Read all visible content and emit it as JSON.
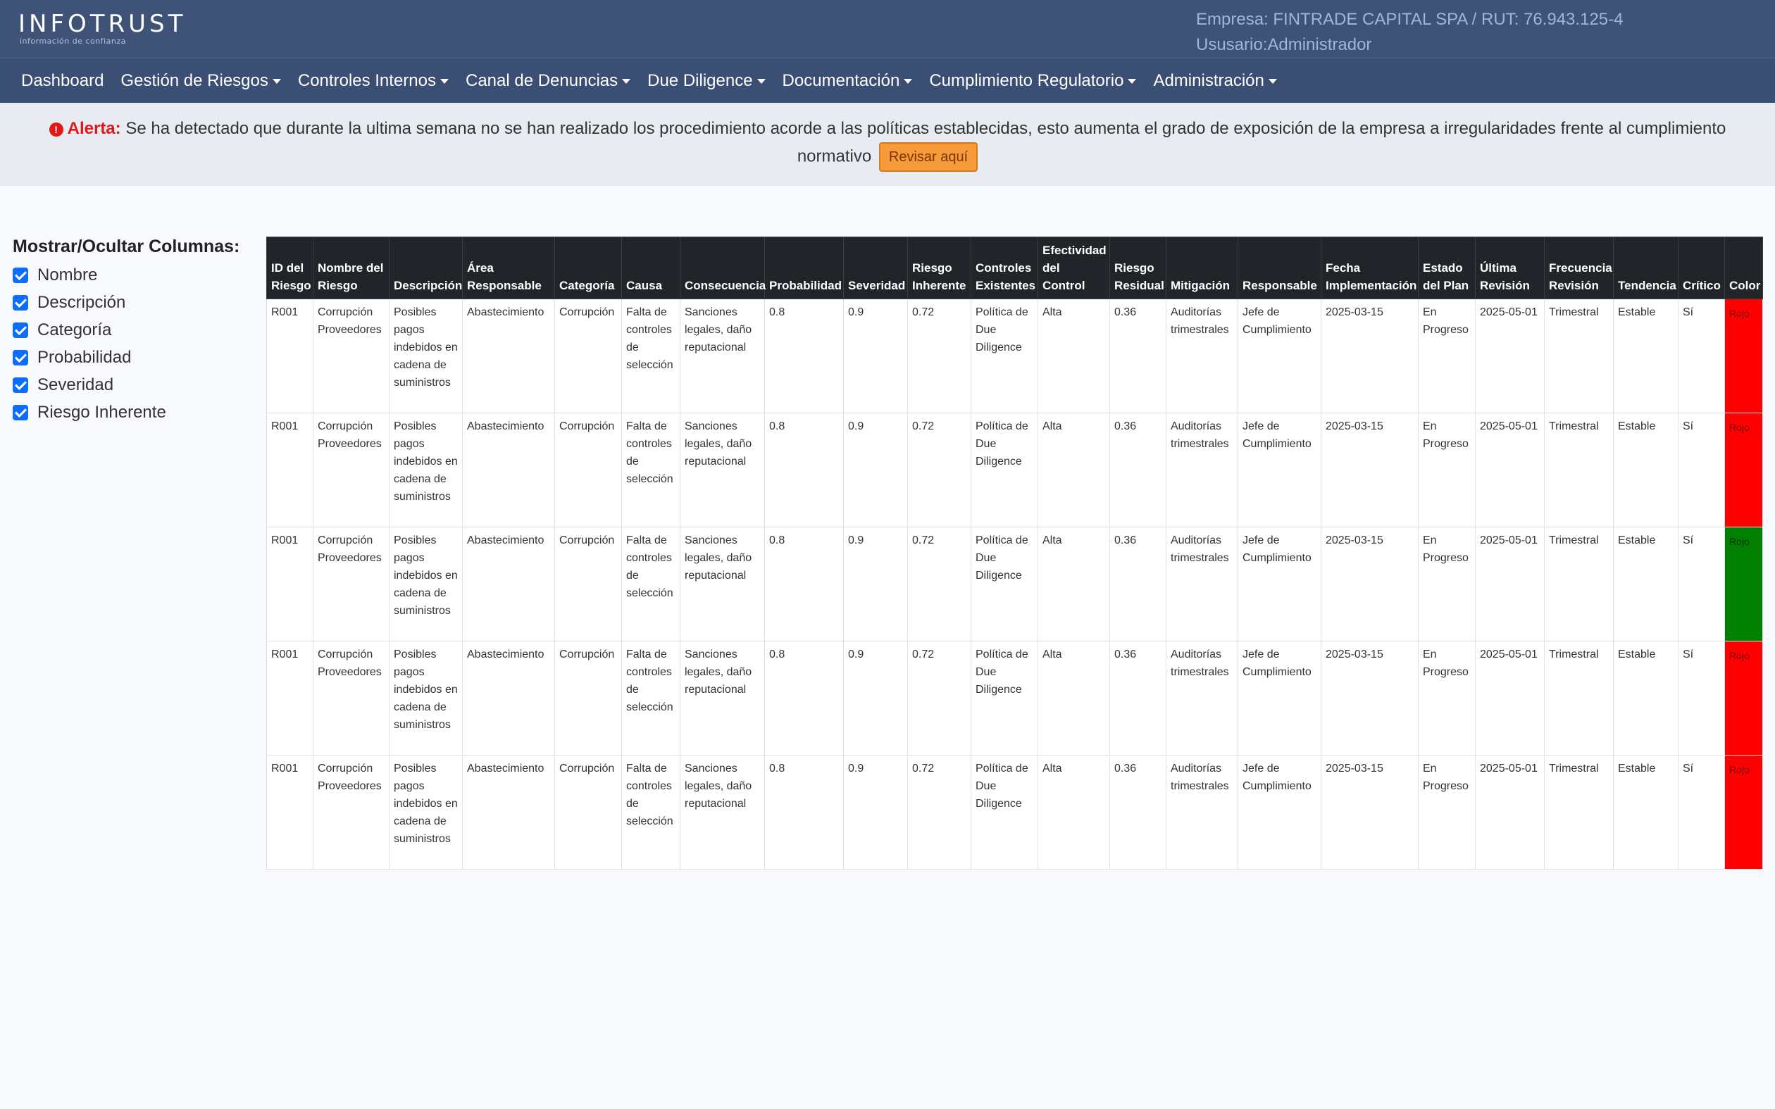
{
  "header": {
    "logo_text": "INFOTRUST",
    "logo_tagline": "información de confianza",
    "company": "Empresa: FINTRADE CAPITAL SPA / RUT: 76.943.125-4",
    "user": "Ususario:Administrador"
  },
  "nav": {
    "items": [
      {
        "label": "Dashboard",
        "dropdown": false
      },
      {
        "label": "Gestión de Riesgos",
        "dropdown": true
      },
      {
        "label": "Controles Internos",
        "dropdown": true
      },
      {
        "label": "Canal de Denuncias",
        "dropdown": true
      },
      {
        "label": "Due Diligence",
        "dropdown": true
      },
      {
        "label": "Documentación",
        "dropdown": true
      },
      {
        "label": "Cumplimiento Regulatorio",
        "dropdown": true
      },
      {
        "label": "Administración",
        "dropdown": true
      }
    ]
  },
  "alert": {
    "icon": "exclamation-circle-icon",
    "label": "Alerta:",
    "message": "Se ha detectado que durante la ultima semana no se han realizado los procedimiento acorde a las políticas establecidas, esto aumenta el grado de exposición de la empresa a irregularidades frente al cumplimiento normativo",
    "button": "Revisar aquí",
    "color": "#e21818"
  },
  "columns_panel": {
    "title": "Mostrar/Ocultar Columnas:",
    "options": [
      {
        "label": "Nombre",
        "checked": true
      },
      {
        "label": "Descripción",
        "checked": true
      },
      {
        "label": "Categoría",
        "checked": true
      },
      {
        "label": "Probabilidad",
        "checked": true
      },
      {
        "label": "Severidad",
        "checked": true
      },
      {
        "label": "Riesgo Inherente",
        "checked": true
      }
    ]
  },
  "table": {
    "headers": [
      "ID del Riesgo",
      "Nombre del Riesgo",
      "Descripción",
      "Área Responsable",
      "Categoría",
      "Causa",
      "Consecuencia",
      "Probabilidad",
      "Severidad",
      "Riesgo Inherente",
      "Controles Existentes",
      "Efectividad del Control",
      "Riesgo Residual",
      "Mitigación",
      "Responsable",
      "Fecha Implementación",
      "Estado del Plan",
      "Última Revisión",
      "Frecuencia Revisión",
      "Tendencia",
      "Crítico",
      "Color"
    ],
    "rows": [
      [
        "R001",
        "Corrupción Proveedores",
        "Posibles pagos indebidos en cadena de suministros",
        "Abastecimiento",
        "Corrupción",
        "Falta de controles de selección",
        "Sanciones legales, daño reputacional",
        "0.8",
        "0.9",
        "0.72",
        "Política de Due Diligence",
        "Alta",
        "0.36",
        "Auditorías trimestrales",
        "Jefe de Cumplimiento",
        "2025-03-15",
        "En Progreso",
        "2025-05-01",
        "Trimestral",
        "Estable",
        "Sí",
        "Rojo"
      ],
      [
        "R001",
        "Corrupción Proveedores",
        "Posibles pagos indebidos en cadena de suministros",
        "Abastecimiento",
        "Corrupción",
        "Falta de controles de selección",
        "Sanciones legales, daño reputacional",
        "0.8",
        "0.9",
        "0.72",
        "Política de Due Diligence",
        "Alta",
        "0.36",
        "Auditorías trimestrales",
        "Jefe de Cumplimiento",
        "2025-03-15",
        "En Progreso",
        "2025-05-01",
        "Trimestral",
        "Estable",
        "Sí",
        "Rojo"
      ],
      [
        "R001",
        "Corrupción Proveedores",
        "Posibles pagos indebidos en cadena de suministros",
        "Abastecimiento",
        "Corrupción",
        "Falta de controles de selección",
        "Sanciones legales, daño reputacional",
        "0.8",
        "0.9",
        "0.72",
        "Política de Due Diligence",
        "Alta",
        "0.36",
        "Auditorías trimestrales",
        "Jefe de Cumplimiento",
        "2025-03-15",
        "En Progreso",
        "2025-05-01",
        "Trimestral",
        "Estable",
        "Sí",
        "Rojo"
      ],
      [
        "R001",
        "Corrupción Proveedores",
        "Posibles pagos indebidos en cadena de suministros",
        "Abastecimiento",
        "Corrupción",
        "Falta de controles de selección",
        "Sanciones legales, daño reputacional",
        "0.8",
        "0.9",
        "0.72",
        "Política de Due Diligence",
        "Alta",
        "0.36",
        "Auditorías trimestrales",
        "Jefe de Cumplimiento",
        "2025-03-15",
        "En Progreso",
        "2025-05-01",
        "Trimestral",
        "Estable",
        "Sí",
        "Rojo"
      ],
      [
        "R001",
        "Corrupción Proveedores",
        "Posibles pagos indebidos en cadena de suministros",
        "Abastecimiento",
        "Corrupción",
        "Falta de controles de selección",
        "Sanciones legales, daño reputacional",
        "0.8",
        "0.9",
        "0.72",
        "Política de Due Diligence",
        "Alta",
        "0.36",
        "Auditorías trimestrales",
        "Jefe de Cumplimiento",
        "2025-03-15",
        "En Progreso",
        "2025-05-01",
        "Trimestral",
        "Estable",
        "Sí",
        "Rojo"
      ]
    ],
    "row_colors": [
      "#ff0000",
      "#ff0000",
      "#008000",
      "#ff0000",
      "#ff0000"
    ]
  }
}
